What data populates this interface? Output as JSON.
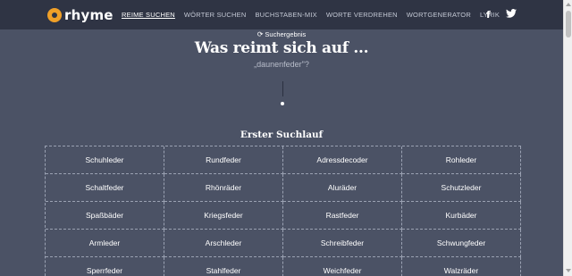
{
  "brand": {
    "name": "rhyme"
  },
  "nav": {
    "items": [
      "REIME SUCHEN",
      "WÖRTER SUCHEN",
      "BUCHSTABEN-MIX",
      "WORTE VERDREHEN",
      "WORTGENERATOR",
      "LYRIK"
    ],
    "active_index": 0
  },
  "social": {
    "facebook": "f",
    "twitter": "🐦"
  },
  "result_badge": {
    "icon": "refresh-icon",
    "label": "Suchergebnis"
  },
  "headline": "Was reimt sich auf ...",
  "query": "„daunenfeder\"?",
  "section_title": "Erster Suchlauf",
  "results": [
    "Schuhleder",
    "Rundfeder",
    "Adressdecoder",
    "Rohleder",
    "Schaltfeder",
    "Rhönräder",
    "Aluräder",
    "Schutzleder",
    "Spaßbäder",
    "Kriegsfeder",
    "Rastfeder",
    "Kurbäder",
    "Armleder",
    "Arschleder",
    "Schreibfeder",
    "Schwungfeder",
    "Sperrfeder",
    "Stahlfeder",
    "Weichfeder",
    "Walzräder"
  ],
  "colors": {
    "background": "#4b5265",
    "topbar": "#2f3444",
    "accent": "#f0a028"
  }
}
